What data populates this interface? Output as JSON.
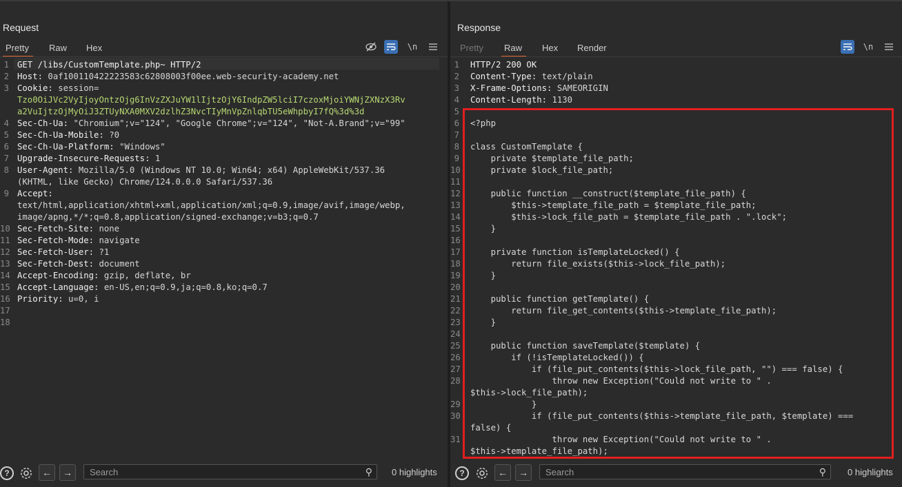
{
  "request": {
    "title": "Request",
    "tabs": [
      "Pretty",
      "Raw",
      "Hex"
    ],
    "active_tab": "Pretty",
    "tool_newline": "\\n",
    "lines": [
      {
        "n": "1",
        "k": "GET /libs/CustomTemplate.php~ HTTP/2",
        "v": ""
      },
      {
        "n": "2",
        "k": "Host: ",
        "v": "0af100110422223583c62808003f00ee.web-security-academy.net"
      },
      {
        "n": "3",
        "k": "Cookie: ",
        "v": "session="
      },
      {
        "n": "",
        "k": "",
        "v": "Tzo0OiJVc2VyIjoyOntzOjg6InVzZXJuYW1lIjtzOjY6IndpZW5lciI7czoxMjoiYWNjZXNzX3Rv"
      },
      {
        "n": "",
        "k": "",
        "v": "a2VuIjtzOjMyOiJ3ZTUyNXA0MXV2dzlhZ3NvcTIyMnVpZnlqbTU5eWhpbyI7fQ%3d%3d"
      },
      {
        "n": "4",
        "k": "Sec-Ch-Ua: ",
        "v": "\"Chromium\";v=\"124\", \"Google Chrome\";v=\"124\", \"Not-A.Brand\";v=\"99\""
      },
      {
        "n": "5",
        "k": "Sec-Ch-Ua-Mobile: ",
        "v": "?0"
      },
      {
        "n": "6",
        "k": "Sec-Ch-Ua-Platform: ",
        "v": "\"Windows\""
      },
      {
        "n": "7",
        "k": "Upgrade-Insecure-Requests: ",
        "v": "1"
      },
      {
        "n": "8",
        "k": "User-Agent: ",
        "v": "Mozilla/5.0 (Windows NT 10.0; Win64; x64) AppleWebKit/537.36"
      },
      {
        "n": "",
        "k": "",
        "v": "(KHTML, like Gecko) Chrome/124.0.0.0 Safari/537.36"
      },
      {
        "n": "9",
        "k": "Accept: ",
        "v": ""
      },
      {
        "n": "",
        "k": "",
        "v": "text/html,application/xhtml+xml,application/xml;q=0.9,image/avif,image/webp,"
      },
      {
        "n": "",
        "k": "",
        "v": "image/apng,*/*;q=0.8,application/signed-exchange;v=b3;q=0.7"
      },
      {
        "n": "10",
        "k": "Sec-Fetch-Site: ",
        "v": "none"
      },
      {
        "n": "11",
        "k": "Sec-Fetch-Mode: ",
        "v": "navigate"
      },
      {
        "n": "12",
        "k": "Sec-Fetch-User: ",
        "v": "?1"
      },
      {
        "n": "13",
        "k": "Sec-Fetch-Dest: ",
        "v": "document"
      },
      {
        "n": "14",
        "k": "Accept-Encoding: ",
        "v": "gzip, deflate, br"
      },
      {
        "n": "15",
        "k": "Accept-Language: ",
        "v": "en-US,en;q=0.9,ja;q=0.8,ko;q=0.7"
      },
      {
        "n": "16",
        "k": "Priority: ",
        "v": "u=0, i"
      },
      {
        "n": "17",
        "k": "",
        "v": ""
      },
      {
        "n": "18",
        "k": "",
        "v": ""
      }
    ],
    "search_placeholder": "Search",
    "highlights": "0 highlights"
  },
  "response": {
    "title": "Response",
    "tabs": [
      "Pretty",
      "Raw",
      "Hex",
      "Render"
    ],
    "active_tab": "Raw",
    "tool_newline": "\\n",
    "lines": [
      {
        "n": "1",
        "k": "HTTP/2 200 OK",
        "v": ""
      },
      {
        "n": "2",
        "k": "Content-Type: ",
        "v": "text/plain"
      },
      {
        "n": "3",
        "k": "X-Frame-Options: ",
        "v": "SAMEORIGIN"
      },
      {
        "n": "4",
        "k": "Content-Length: ",
        "v": "1130"
      },
      {
        "n": "5",
        "k": "",
        "v": ""
      },
      {
        "n": "6",
        "k": "",
        "v": "<?php"
      },
      {
        "n": "7",
        "k": "",
        "v": ""
      },
      {
        "n": "8",
        "k": "",
        "v": "class CustomTemplate {"
      },
      {
        "n": "9",
        "k": "",
        "v": "    private $template_file_path;"
      },
      {
        "n": "10",
        "k": "",
        "v": "    private $lock_file_path;"
      },
      {
        "n": "11",
        "k": "",
        "v": ""
      },
      {
        "n": "12",
        "k": "",
        "v": "    public function __construct($template_file_path) {"
      },
      {
        "n": "13",
        "k": "",
        "v": "        $this->template_file_path = $template_file_path;"
      },
      {
        "n": "14",
        "k": "",
        "v": "        $this->lock_file_path = $template_file_path . \".lock\";"
      },
      {
        "n": "15",
        "k": "",
        "v": "    }"
      },
      {
        "n": "16",
        "k": "",
        "v": ""
      },
      {
        "n": "17",
        "k": "",
        "v": "    private function isTemplateLocked() {"
      },
      {
        "n": "18",
        "k": "",
        "v": "        return file_exists($this->lock_file_path);"
      },
      {
        "n": "19",
        "k": "",
        "v": "    }"
      },
      {
        "n": "20",
        "k": "",
        "v": ""
      },
      {
        "n": "21",
        "k": "",
        "v": "    public function getTemplate() {"
      },
      {
        "n": "22",
        "k": "",
        "v": "        return file_get_contents($this->template_file_path);"
      },
      {
        "n": "23",
        "k": "",
        "v": "    }"
      },
      {
        "n": "24",
        "k": "",
        "v": ""
      },
      {
        "n": "25",
        "k": "",
        "v": "    public function saveTemplate($template) {"
      },
      {
        "n": "26",
        "k": "",
        "v": "        if (!isTemplateLocked()) {"
      },
      {
        "n": "27",
        "k": "",
        "v": "            if (file_put_contents($this->lock_file_path, \"\") === false) {"
      },
      {
        "n": "28",
        "k": "",
        "v": "                throw new Exception(\"Could not write to \" ."
      },
      {
        "n": "",
        "k": "",
        "v": "$this->lock_file_path);"
      },
      {
        "n": "29",
        "k": "",
        "v": "            }"
      },
      {
        "n": "30",
        "k": "",
        "v": "            if (file_put_contents($this->template_file_path, $template) ==="
      },
      {
        "n": "",
        "k": "",
        "v": "false) {"
      },
      {
        "n": "31",
        "k": "",
        "v": "                throw new Exception(\"Could not write to \" ."
      },
      {
        "n": "",
        "k": "",
        "v": "$this->template_file_path);"
      },
      {
        "n": "",
        "k": "",
        "v": "            }"
      }
    ],
    "search_placeholder": "Search",
    "highlights": "0 highlights"
  },
  "colors": {
    "accent_tab": "#e0642e",
    "highlight_box": "#e21f1f",
    "active_tool": "#3a6fb4",
    "cookie_value": "#b7d873"
  }
}
